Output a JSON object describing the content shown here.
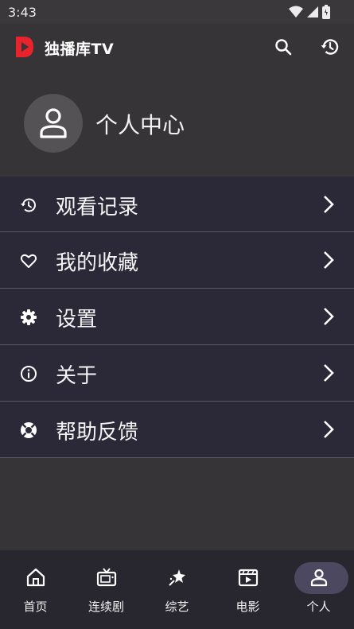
{
  "status_bar": {
    "time": "3:43"
  },
  "app_bar": {
    "title": "独播库TV",
    "logo_color": "#e8232b",
    "actions": [
      "search-icon",
      "history-icon"
    ]
  },
  "profile": {
    "name": "个人中心",
    "avatar_icon": "person-icon"
  },
  "menu": {
    "items": [
      {
        "label": "观看记录",
        "icon": "history-icon"
      },
      {
        "label": "我的收藏",
        "icon": "heart-icon"
      },
      {
        "label": "设置",
        "icon": "gear-icon"
      },
      {
        "label": "关于",
        "icon": "info-icon"
      },
      {
        "label": "帮助反馈",
        "icon": "lifebuoy-icon"
      }
    ]
  },
  "bottom_nav": {
    "items": [
      {
        "label": "首页",
        "icon": "home-icon"
      },
      {
        "label": "连续剧",
        "icon": "tv-icon"
      },
      {
        "label": "综艺",
        "icon": "star-icon"
      },
      {
        "label": "电影",
        "icon": "film-icon"
      },
      {
        "label": "个人",
        "icon": "person-icon",
        "active": true
      }
    ],
    "active_color": "#4c4860"
  },
  "colors": {
    "background": "#363436",
    "menu_background": "#2b2838",
    "nav_background": "#28262e"
  }
}
